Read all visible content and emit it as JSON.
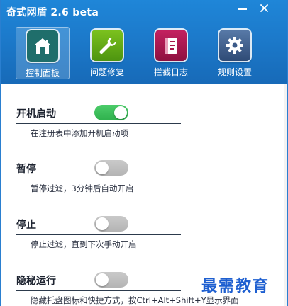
{
  "window": {
    "title": "奇式网盾 2.6 beta",
    "minimize_label": "—",
    "close_label": "✕"
  },
  "toolbar": {
    "items": [
      {
        "label": "控制面板",
        "icon": "home-icon",
        "active": true,
        "color": "#1f6e6b"
      },
      {
        "label": "问题修复",
        "icon": "wrench-icon",
        "active": false,
        "color": "#5fa312"
      },
      {
        "label": "拦截日志",
        "icon": "log-book-icon",
        "active": false,
        "color": "#a8174a"
      },
      {
        "label": "规则设置",
        "icon": "gear-icon",
        "active": false,
        "color": "#3c5a88"
      }
    ]
  },
  "settings": [
    {
      "title": "开机启动",
      "enabled": true,
      "description": "在注册表中添加开机启动项"
    },
    {
      "title": "暂停",
      "enabled": false,
      "description": "暂停过滤，3分钟后自动开启"
    },
    {
      "title": "停止",
      "enabled": false,
      "description": "停止过滤，直到下次手动开启"
    },
    {
      "title": "隐秘运行",
      "enabled": false,
      "description": "隐藏托盘图标和快捷方式，按Ctrl+Alt+Shift+Y显示界面"
    }
  ],
  "watermark": "最需教育",
  "colors": {
    "header": "#1c7acb",
    "toggle_on": "#3cbf5a",
    "toggle_off": "#bdbdbd"
  }
}
